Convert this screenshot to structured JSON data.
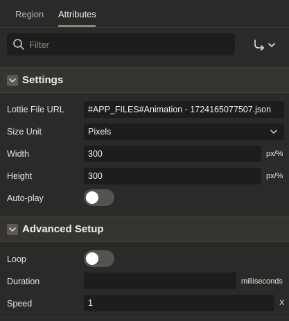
{
  "tabs": {
    "region": "Region",
    "attributes": "Attributes",
    "active": "attributes"
  },
  "filter": {
    "placeholder": "Filter",
    "value": "",
    "search_icon": "search-icon",
    "goto_icon": "go-to-group-icon"
  },
  "settings": {
    "title": "Settings",
    "lottie_file_url": {
      "label": "Lottie File URL",
      "value": "#APP_FILES#Animation - 1724165077507.json"
    },
    "size_unit": {
      "label": "Size Unit",
      "value": "Pixels"
    },
    "width": {
      "label": "Width",
      "value": "300",
      "unit": "px/%"
    },
    "height": {
      "label": "Height",
      "value": "300",
      "unit": "px/%"
    },
    "autoplay": {
      "label": "Auto-play",
      "on": false
    }
  },
  "advanced": {
    "title": "Advanced Setup",
    "loop": {
      "label": "Loop",
      "on": false
    },
    "duration": {
      "label": "Duration",
      "value": "",
      "unit": "milliseconds"
    },
    "speed": {
      "label": "Speed",
      "value": "1",
      "unit": "X"
    }
  },
  "colors": {
    "background": "#2b2a28",
    "field": "#1e1d1b",
    "section_header": "#36342f",
    "tab_accent": "#6f9b6c",
    "toggle_off": "#55534f"
  }
}
